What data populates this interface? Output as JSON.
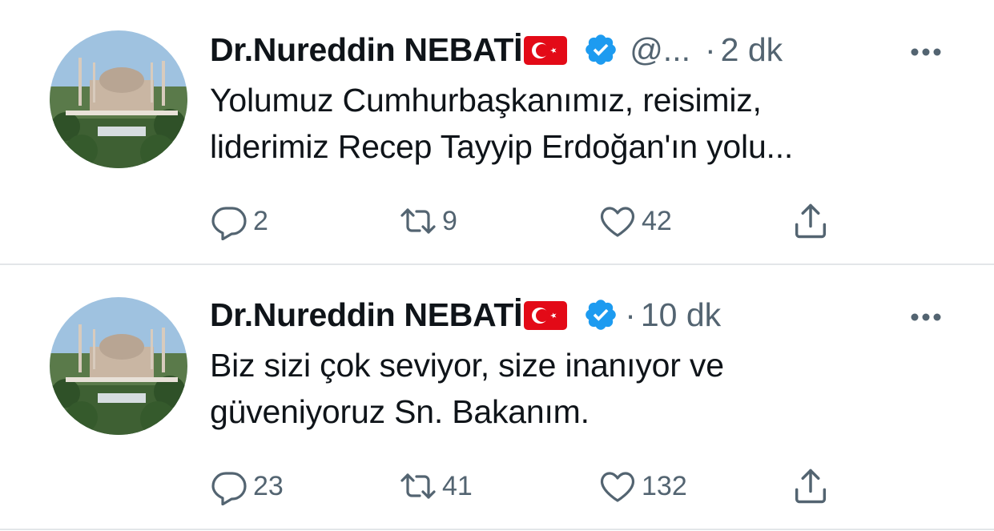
{
  "tweets": [
    {
      "author_name": "Dr.Nureddin NEBATİ",
      "handle": "@...",
      "separator": "·",
      "time": "2 dk",
      "text_lines": [
        "Yolumuz Cumhurbaşkanımız, reisimiz,",
        "liderimiz Recep Tayyip Erdoğan'ın yolu..."
      ],
      "replies": "2",
      "retweets": "9",
      "likes": "42"
    },
    {
      "author_name": "Dr.Nureddin NEBATİ",
      "handle": "",
      "separator": "·",
      "time": "10 dk",
      "text_lines": [
        "Biz sizi çok seviyor, size inanıyor ve",
        "güveniyoruz Sn. Bakanım."
      ],
      "replies": "23",
      "retweets": "41",
      "likes": "132"
    }
  ],
  "colors": {
    "text": "#0f1419",
    "muted": "#536471",
    "verified": "#1d9bf0",
    "divider": "#e3e6e9",
    "flag_red": "#e30a17"
  },
  "icons": {
    "flag": "turkey-flag-icon",
    "verified": "verified-badge-icon",
    "more": "more-dots-icon",
    "reply": "reply-icon",
    "retweet": "retweet-icon",
    "like": "heart-icon",
    "share": "share-icon"
  }
}
